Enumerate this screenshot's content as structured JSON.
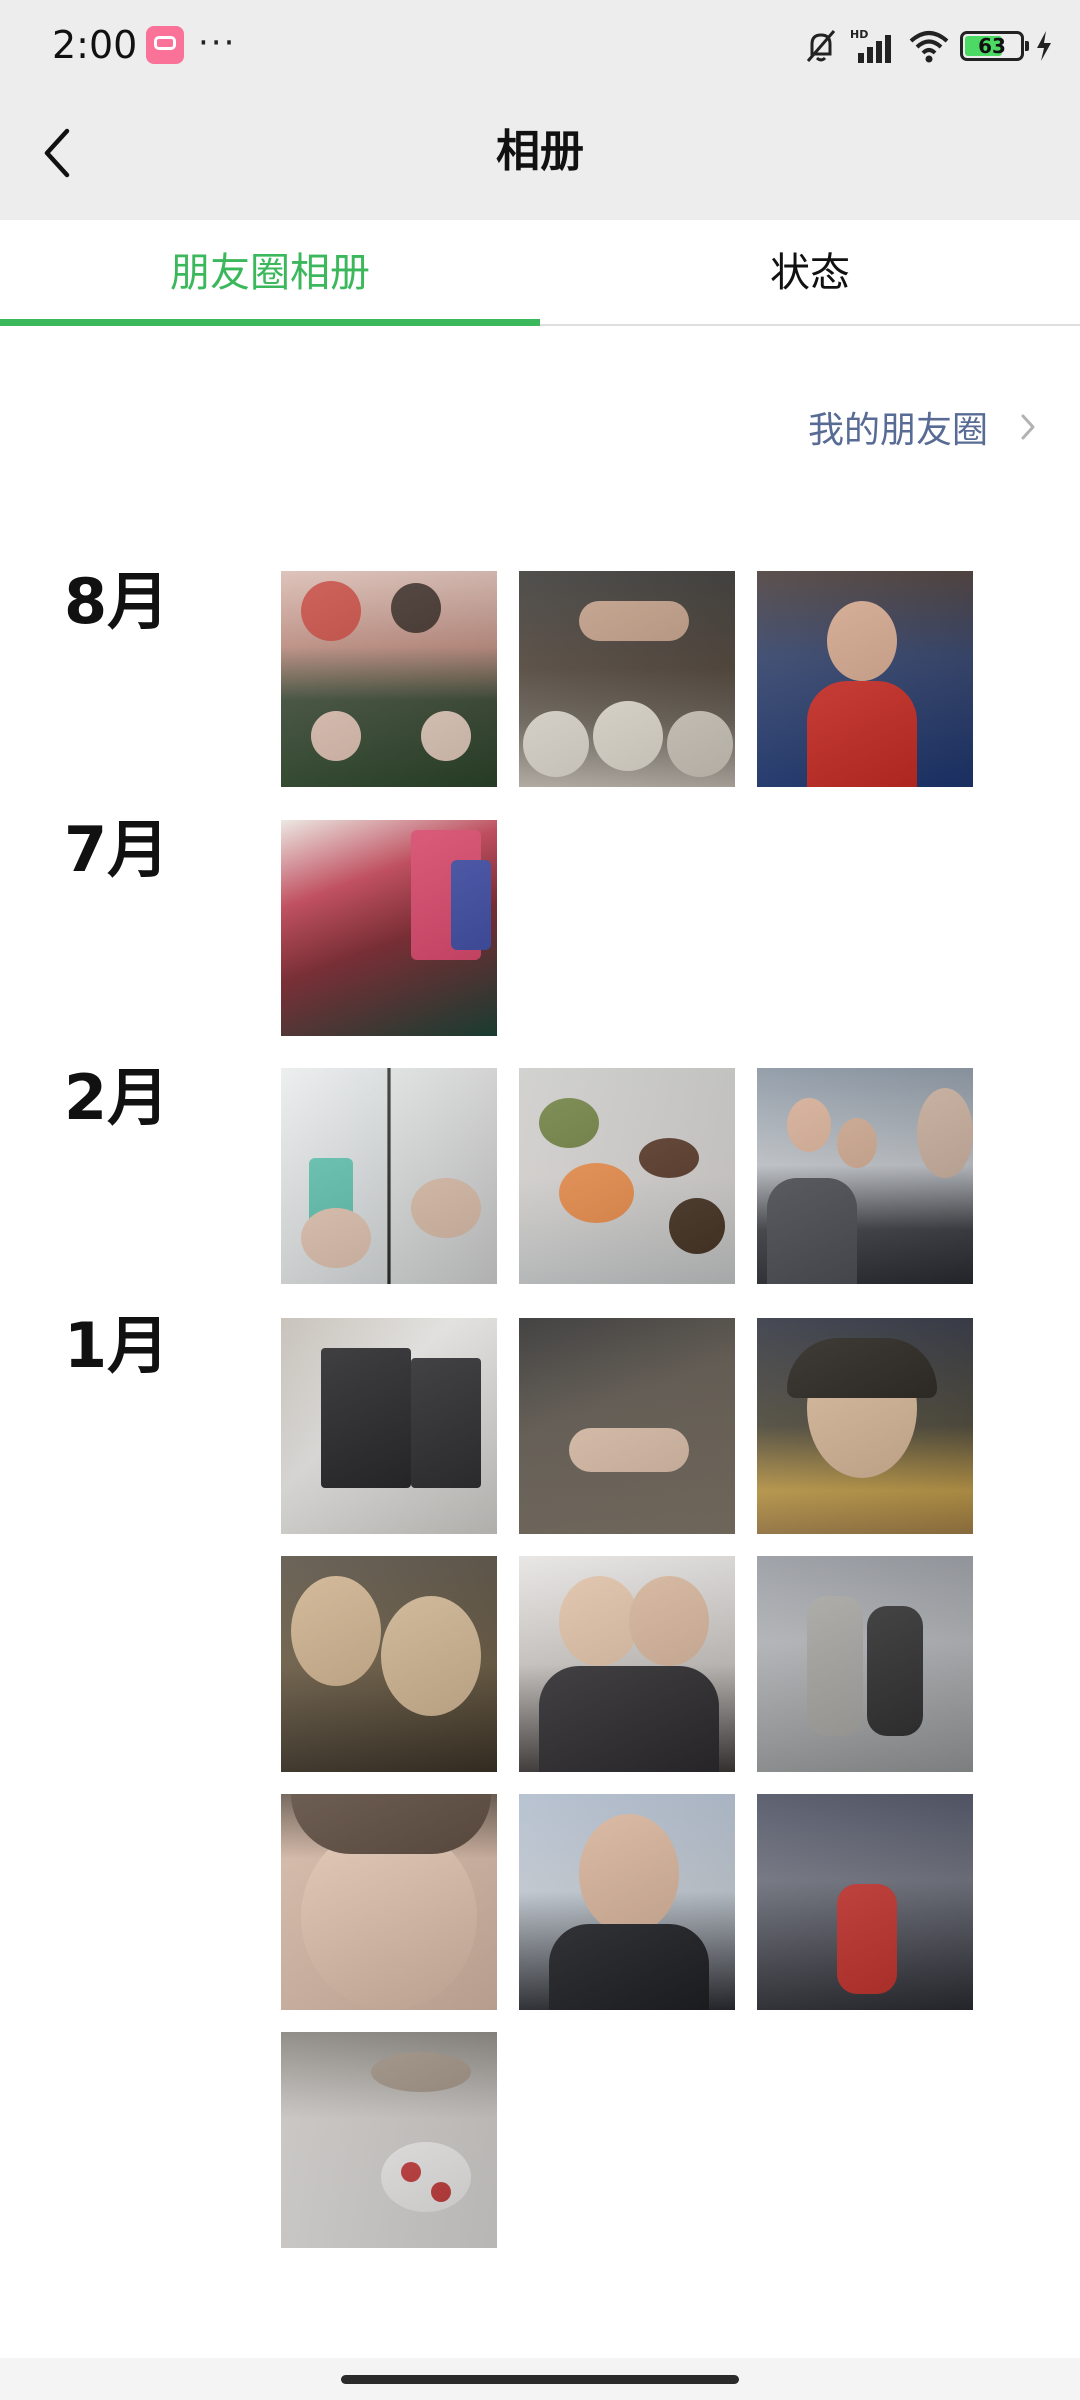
{
  "status_bar": {
    "time": "2:00",
    "more": "···",
    "battery": "63",
    "battery_level": 0.63,
    "icons": [
      "bilibili-app-icon",
      "silent-bell-icon",
      "hd-signal-icon",
      "wifi-icon",
      "battery-icon",
      "charging-bolt-icon"
    ]
  },
  "header": {
    "title": "相册"
  },
  "tabs": [
    {
      "label": "朋友圈相册",
      "active": true
    },
    {
      "label": "状态",
      "active": false
    }
  ],
  "moments_link": {
    "label": "我的朋友圈"
  },
  "albums": [
    {
      "month": "8月",
      "photo_count": 3
    },
    {
      "month": "7月",
      "photo_count": 1
    },
    {
      "month": "2月",
      "photo_count": 3
    },
    {
      "month": "1月",
      "photo_count": 10
    }
  ],
  "colors": {
    "accent": "#3cb85c",
    "link": "#576b95",
    "header_bg": "#ededed"
  }
}
